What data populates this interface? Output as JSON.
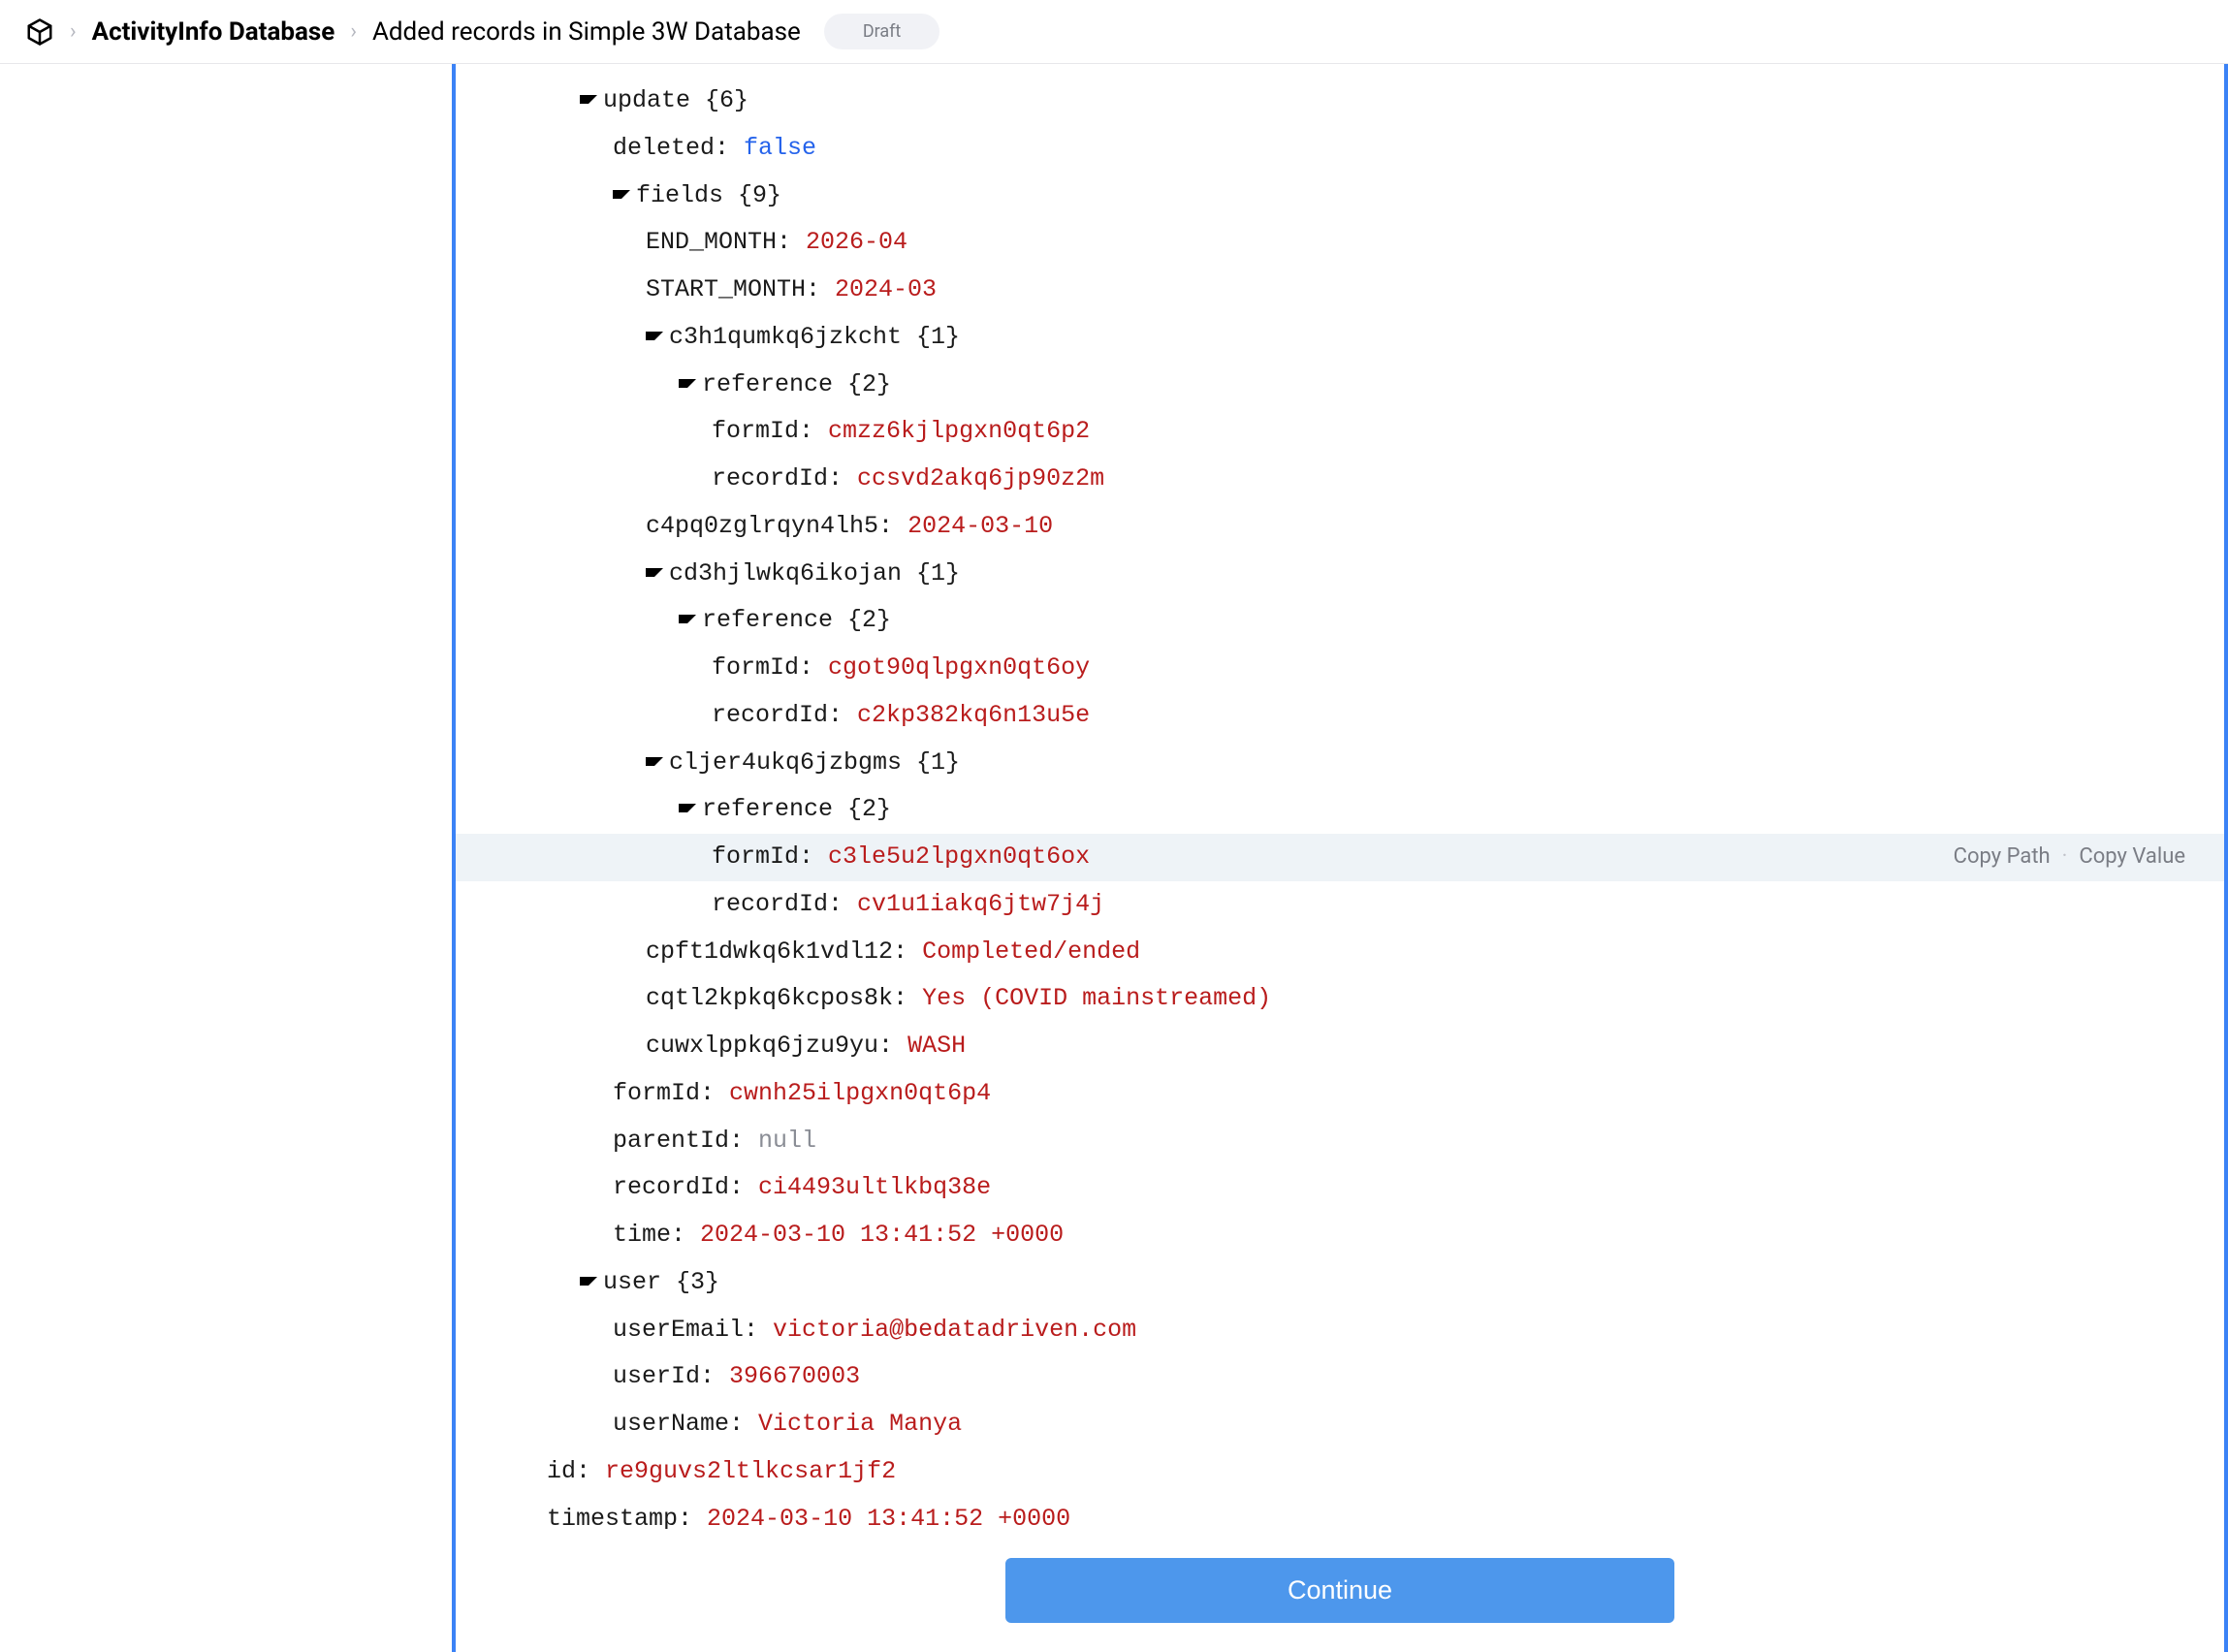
{
  "breadcrumb": {
    "root": "ActivityInfo Database",
    "leaf": "Added records in Simple 3W Database",
    "badge": "Draft"
  },
  "actions": {
    "copy_path": "Copy Path",
    "copy_value": "Copy Value",
    "continue": "Continue"
  },
  "tree": [
    {
      "depth": 2,
      "caret": true,
      "key": "update",
      "meta": "{6}"
    },
    {
      "depth": 3,
      "caret": false,
      "key": "deleted:",
      "val": "false",
      "vtype": "bool"
    },
    {
      "depth": 3,
      "caret": true,
      "key": "fields",
      "meta": "{9}"
    },
    {
      "depth": 4,
      "caret": false,
      "key": "END_MONTH:",
      "val": "2026-04",
      "vtype": "str"
    },
    {
      "depth": 4,
      "caret": false,
      "key": "START_MONTH:",
      "val": "2024-03",
      "vtype": "str"
    },
    {
      "depth": 4,
      "caret": true,
      "key": "c3h1qumkq6jzkcht",
      "meta": "{1}"
    },
    {
      "depth": 5,
      "caret": true,
      "key": "reference",
      "meta": "{2}"
    },
    {
      "depth": 6,
      "caret": false,
      "key": "formId:",
      "val": "cmzz6kjlpgxn0qt6p2",
      "vtype": "str"
    },
    {
      "depth": 6,
      "caret": false,
      "key": "recordId:",
      "val": "ccsvd2akq6jp90z2m",
      "vtype": "str"
    },
    {
      "depth": 4,
      "caret": false,
      "key": "c4pq0zglrqyn4lh5:",
      "val": "2024-03-10",
      "vtype": "str"
    },
    {
      "depth": 4,
      "caret": true,
      "key": "cd3hjlwkq6ikojan",
      "meta": "{1}"
    },
    {
      "depth": 5,
      "caret": true,
      "key": "reference",
      "meta": "{2}"
    },
    {
      "depth": 6,
      "caret": false,
      "key": "formId:",
      "val": "cgot90qlpgxn0qt6oy",
      "vtype": "str"
    },
    {
      "depth": 6,
      "caret": false,
      "key": "recordId:",
      "val": "c2kp382kq6n13u5e",
      "vtype": "str"
    },
    {
      "depth": 4,
      "caret": true,
      "key": "cljer4ukq6jzbgms",
      "meta": "{1}"
    },
    {
      "depth": 5,
      "caret": true,
      "key": "reference",
      "meta": "{2}"
    },
    {
      "depth": 6,
      "caret": false,
      "key": "formId:",
      "val": "c3le5u2lpgxn0qt6ox",
      "vtype": "str",
      "hl": true
    },
    {
      "depth": 6,
      "caret": false,
      "key": "recordId:",
      "val": "cv1u1iakq6jtw7j4j",
      "vtype": "str"
    },
    {
      "depth": 4,
      "caret": false,
      "key": "cpft1dwkq6k1vdl12:",
      "val": "Completed/ended",
      "vtype": "str"
    },
    {
      "depth": 4,
      "caret": false,
      "key": "cqtl2kpkq6kcpos8k:",
      "val": "Yes  (COVID mainstreamed)",
      "vtype": "str"
    },
    {
      "depth": 4,
      "caret": false,
      "key": "cuwxlppkq6jzu9yu:",
      "val": "WASH",
      "vtype": "str"
    },
    {
      "depth": 3,
      "caret": false,
      "key": "formId:",
      "val": "cwnh25ilpgxn0qt6p4",
      "vtype": "str"
    },
    {
      "depth": 3,
      "caret": false,
      "key": "parentId:",
      "val": "null",
      "vtype": "null"
    },
    {
      "depth": 3,
      "caret": false,
      "key": "recordId:",
      "val": "ci4493ultlkbq38e",
      "vtype": "str"
    },
    {
      "depth": 3,
      "caret": false,
      "key": "time:",
      "val": "2024-03-10 13:41:52 +0000",
      "vtype": "str"
    },
    {
      "depth": 2,
      "caret": true,
      "key": "user",
      "meta": "{3}"
    },
    {
      "depth": 3,
      "caret": false,
      "key": "userEmail:",
      "val": "victoria@bedatadriven.com",
      "vtype": "str"
    },
    {
      "depth": 3,
      "caret": false,
      "key": "userId:",
      "val": "396670003",
      "vtype": "str"
    },
    {
      "depth": 3,
      "caret": false,
      "key": "userName:",
      "val": "Victoria Manya",
      "vtype": "str"
    },
    {
      "depth": 1,
      "caret": false,
      "key": "id:",
      "val": "re9guvs2ltlkcsar1jf2",
      "vtype": "str"
    },
    {
      "depth": 1,
      "caret": false,
      "key": "timestamp:",
      "val": "2024-03-10 13:41:52 +0000",
      "vtype": "str",
      "cut": true
    }
  ]
}
